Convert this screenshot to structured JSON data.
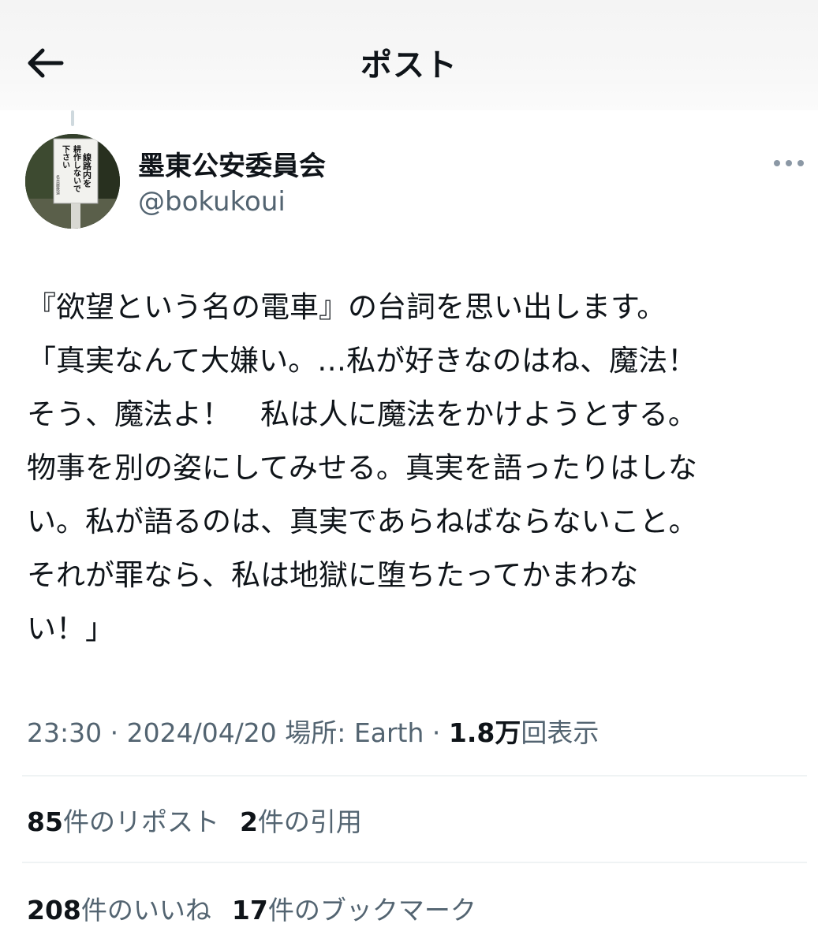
{
  "header": {
    "title": "ポスト",
    "back_icon": "arrow-left-icon"
  },
  "author": {
    "display_name": "墨東公安委員会",
    "handle": "@bokukoui",
    "avatar_sign_text": [
      "線路内を",
      "耕作しないで",
      "下さい",
      "名古屋鉄道"
    ]
  },
  "post": {
    "text": "『欲望という名の電車』の台詞を思い出します。\n「真実なんて大嫌い。…私が好きなのはね、魔法！\nそう、魔法よ！　私は人に魔法をかけようとする。\n物事を別の姿にしてみせる。真実を語ったりはしな\nい。私が語るのは、真実であらねばならないこと。\nそれが罪なら、私は地獄に堕ちたってかまわな\nい！」",
    "time": "23:30",
    "separator": " · ",
    "date": "2024/04/20",
    "location": "場所: Earth",
    "views_count": "1.8万",
    "views_label": "回表示"
  },
  "stats": {
    "reposts_count": "85",
    "reposts_label": "件のリポスト",
    "quotes_count": "2",
    "quotes_label": "件の引用",
    "likes_count": "208",
    "likes_label": "件のいいね",
    "bookmarks_count": "17",
    "bookmarks_label": "件のブックマーク"
  },
  "colors": {
    "text_primary": "#0f1419",
    "text_secondary": "#536471",
    "divider": "#eff3f4"
  }
}
